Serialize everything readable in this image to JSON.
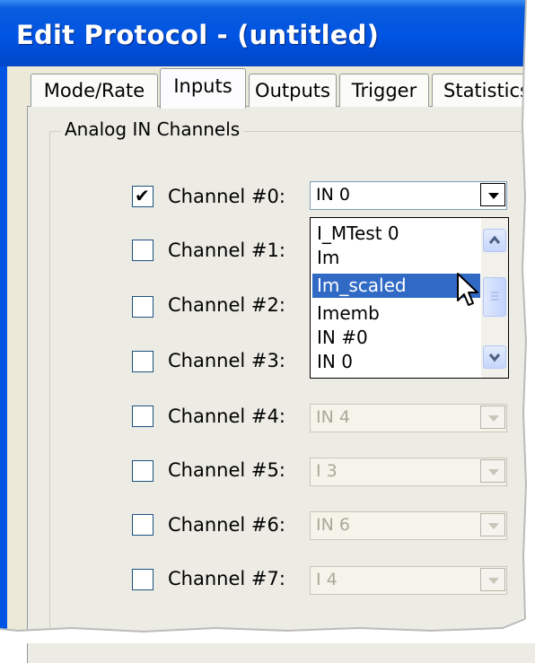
{
  "window": {
    "title": "Edit Protocol - (untitled)"
  },
  "tabs": [
    {
      "label": "Mode/Rate",
      "active": false
    },
    {
      "label": "Inputs",
      "active": true
    },
    {
      "label": "Outputs",
      "active": false
    },
    {
      "label": "Trigger",
      "active": false
    },
    {
      "label": "Statistics",
      "active": false
    }
  ],
  "group": {
    "title": "Analog IN Channels"
  },
  "channels": [
    {
      "label": "Channel #0:",
      "checked": true,
      "value": "IN 0",
      "enabled": true
    },
    {
      "label": "Channel #1:",
      "checked": false,
      "value": "",
      "enabled": false
    },
    {
      "label": "Channel #2:",
      "checked": false,
      "value": "",
      "enabled": false
    },
    {
      "label": "Channel #3:",
      "checked": false,
      "value": "",
      "enabled": false
    },
    {
      "label": "Channel #4:",
      "checked": false,
      "value": "IN 4",
      "enabled": false
    },
    {
      "label": "Channel #5:",
      "checked": false,
      "value": "I 3",
      "enabled": false
    },
    {
      "label": "Channel #6:",
      "checked": false,
      "value": "IN 6",
      "enabled": false
    },
    {
      "label": "Channel #7:",
      "checked": false,
      "value": "I 4",
      "enabled": false
    }
  ],
  "dropdown": {
    "items": [
      "I_MTest 0",
      "Im",
      "Im_scaled",
      "Imemb",
      "IN #0",
      "IN 0"
    ],
    "selected_index": 2
  },
  "colors": {
    "title_bar": "#0054e3",
    "selection": "#316ac5",
    "panel": "#ecebe4"
  }
}
